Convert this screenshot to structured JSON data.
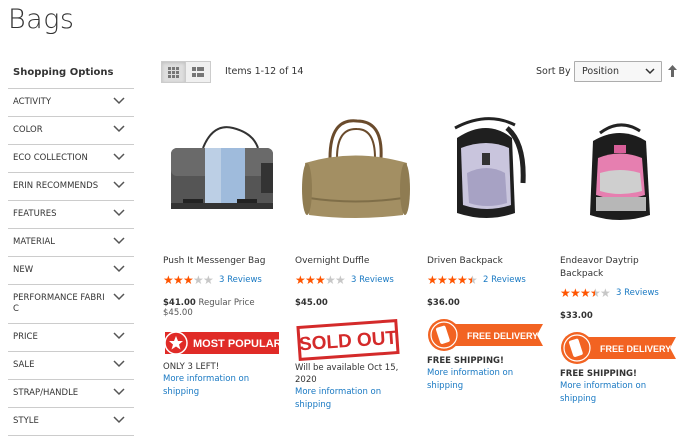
{
  "page": {
    "title": "Bags"
  },
  "sidebar": {
    "title": "Shopping Options",
    "filters": [
      "ACTIVITY",
      "COLOR",
      "ECO COLLECTION",
      "ERIN RECOMMENDS",
      "FEATURES",
      "MATERIAL",
      "NEW",
      "PERFORMANCE FABRIC",
      "PRICE",
      "SALE",
      "STRAP/HANDLE",
      "STYLE"
    ]
  },
  "toolbar": {
    "items_count": "Items 1-12 of 14",
    "sort_label": "Sort By",
    "sort_value": "Position"
  },
  "products": [
    {
      "name": "Push It Messenger Bag",
      "rating": 0.6,
      "reviews": "3 Reviews",
      "price": "$41.00",
      "regular_price": "Regular Price $45.00",
      "badge": "MOST POPULAR",
      "note": "ONLY 3 LEFT!",
      "link": "More information on shipping"
    },
    {
      "name": "Overnight Duffle",
      "rating": 0.6,
      "reviews": "3 Reviews",
      "price": "$45.00",
      "badge": "SOLD OUT",
      "note": "Will be available Oct 15, 2020",
      "link": "More information on shipping"
    },
    {
      "name": "Driven Backpack",
      "rating": 0.9,
      "reviews": "2 Reviews",
      "price": "$36.00",
      "badge": "FREE DELIVERY",
      "note": "FREE SHIPPING!",
      "link": "More information on shipping"
    },
    {
      "name": "Endeavor Daytrip Backpack",
      "rating": 0.7,
      "reviews": "3 Reviews",
      "price": "$33.00",
      "badge": "FREE DELIVERY",
      "note": "FREE SHIPPING!",
      "link": "More information on shipping"
    }
  ],
  "colors": {
    "link": "#1979c3",
    "star": "#ff5501",
    "badge_red": "#e02b27",
    "badge_orange": "#f26322"
  }
}
